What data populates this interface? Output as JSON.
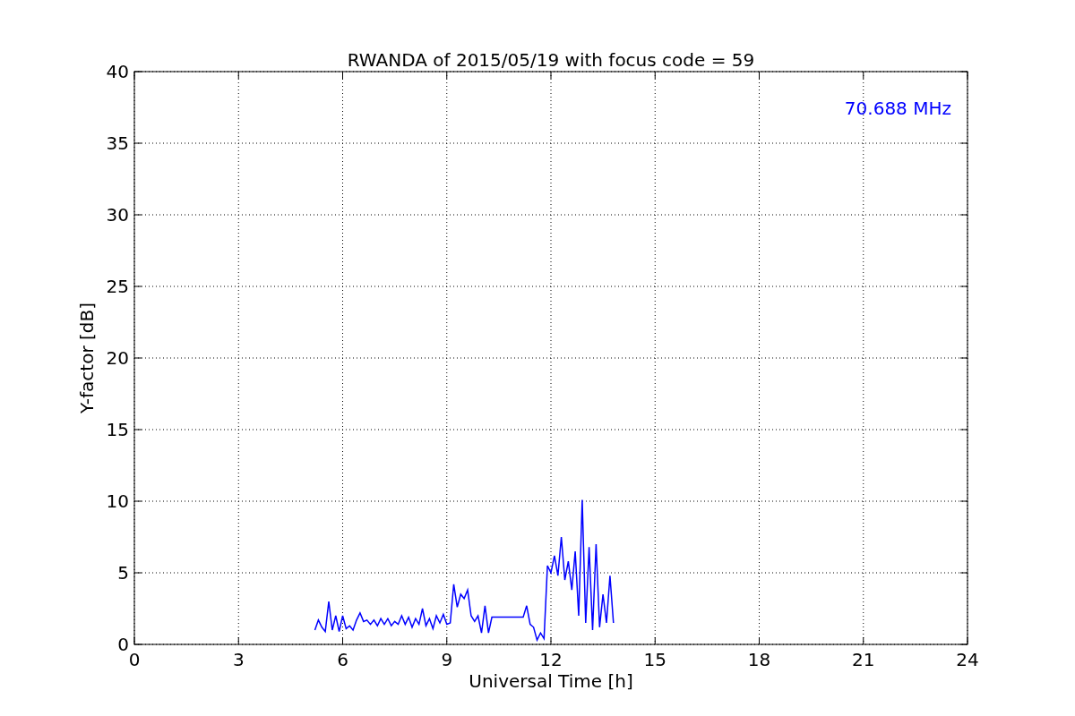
{
  "chart_data": {
    "type": "line",
    "title": "RWANDA of 2015/05/19 with focus code = 59",
    "xlabel": "Universal Time [h]",
    "ylabel": "Y-factor [dB]",
    "x": [
      5.2,
      5.3,
      5.4,
      5.5,
      5.6,
      5.7,
      5.8,
      5.9,
      6.0,
      6.1,
      6.2,
      6.3,
      6.4,
      6.5,
      6.6,
      6.7,
      6.8,
      6.9,
      7.0,
      7.1,
      7.2,
      7.3,
      7.4,
      7.5,
      7.6,
      7.7,
      7.8,
      7.9,
      8.0,
      8.1,
      8.2,
      8.3,
      8.4,
      8.5,
      8.6,
      8.7,
      8.8,
      8.9,
      9.0,
      9.1,
      9.2,
      9.3,
      9.4,
      9.5,
      9.6,
      9.7,
      9.8,
      9.9,
      10.0,
      10.1,
      10.2,
      10.3,
      11.2,
      11.3,
      11.4,
      11.5,
      11.6,
      11.7,
      11.8,
      11.9,
      12.0,
      12.1,
      12.2,
      12.3,
      12.4,
      12.5,
      12.6,
      12.7,
      12.8,
      12.9,
      13.0,
      13.1,
      13.2,
      13.3,
      13.4,
      13.5,
      13.6,
      13.7,
      13.8
    ],
    "series": [
      {
        "name": "70.688 MHz",
        "color": "#0000ff",
        "values": [
          1.0,
          1.7,
          1.2,
          0.9,
          3.0,
          1.0,
          2.0,
          0.9,
          2.0,
          1.1,
          1.3,
          1.0,
          1.7,
          2.2,
          1.6,
          1.7,
          1.4,
          1.7,
          1.3,
          1.8,
          1.4,
          1.8,
          1.3,
          1.6,
          1.4,
          2.0,
          1.4,
          1.9,
          1.2,
          1.8,
          1.4,
          2.5,
          1.3,
          1.8,
          1.1,
          2.0,
          1.5,
          2.1,
          1.4,
          1.5,
          4.2,
          2.6,
          3.5,
          3.2,
          3.8,
          2.0,
          1.6,
          2.0,
          0.8,
          2.7,
          0.8,
          1.9,
          1.9,
          2.7,
          1.4,
          1.2,
          0.3,
          0.8,
          0.4,
          5.5,
          5.0,
          6.2,
          4.8,
          7.5,
          4.5,
          5.8,
          3.8,
          6.5,
          2.0,
          10.1,
          1.5,
          6.8,
          1.0,
          7.0,
          1.2,
          3.5,
          1.5,
          4.8,
          1.5
        ]
      }
    ],
    "xlim": [
      0,
      24
    ],
    "ylim": [
      0,
      40
    ],
    "xticks": [
      0,
      3,
      6,
      9,
      12,
      15,
      18,
      21,
      24
    ],
    "yticks": [
      0,
      5,
      10,
      15,
      20,
      25,
      30,
      35,
      40
    ],
    "grid": true
  }
}
